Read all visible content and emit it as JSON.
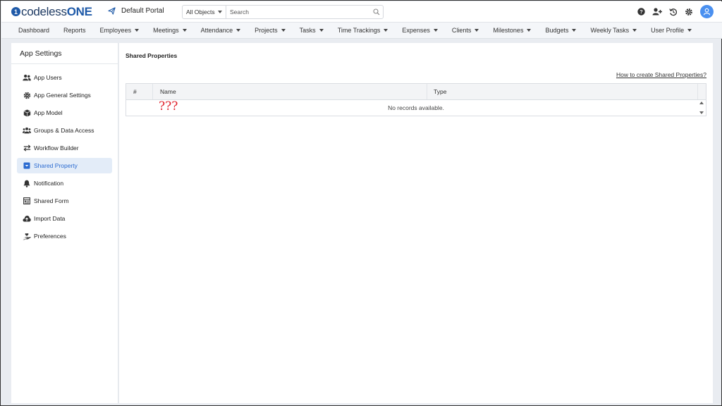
{
  "brand": {
    "logo_mark": "1",
    "logo_pre": "codeless",
    "logo_post": "ONE"
  },
  "portal": {
    "name": "Default Portal",
    "icon": "send-icon"
  },
  "search": {
    "scope": "All Objects",
    "placeholder": "Search"
  },
  "top_icons": [
    "help-icon",
    "add-user-icon",
    "history-icon",
    "settings-icon",
    "user-avatar-icon"
  ],
  "nav": {
    "items": [
      {
        "label": "Dashboard",
        "dropdown": false
      },
      {
        "label": "Reports",
        "dropdown": false
      },
      {
        "label": "Employees",
        "dropdown": true
      },
      {
        "label": "Meetings",
        "dropdown": true
      },
      {
        "label": "Attendance",
        "dropdown": true
      },
      {
        "label": "Projects",
        "dropdown": true
      },
      {
        "label": "Tasks",
        "dropdown": true
      },
      {
        "label": "Time Trackings",
        "dropdown": true
      },
      {
        "label": "Expenses",
        "dropdown": true
      },
      {
        "label": "Clients",
        "dropdown": true
      },
      {
        "label": "Milestones",
        "dropdown": true
      },
      {
        "label": "Budgets",
        "dropdown": true
      },
      {
        "label": "Weekly Tasks",
        "dropdown": true
      },
      {
        "label": "User Profile",
        "dropdown": true
      }
    ]
  },
  "sidebar": {
    "title": "App Settings",
    "items": [
      {
        "label": "App Users",
        "icon": "users-icon",
        "active": false
      },
      {
        "label": "App General Settings",
        "icon": "gear-icon",
        "active": false
      },
      {
        "label": "App Model",
        "icon": "cube-icon",
        "active": false
      },
      {
        "label": "Groups & Data Access",
        "icon": "group-icon",
        "active": false
      },
      {
        "label": "Workflow Builder",
        "icon": "swap-arrows-icon",
        "active": false
      },
      {
        "label": "Shared Property",
        "icon": "dropdown-box-icon",
        "active": true
      },
      {
        "label": "Notification",
        "icon": "bell-icon",
        "active": false
      },
      {
        "label": "Shared Form",
        "icon": "form-icon",
        "active": false
      },
      {
        "label": "Import Data",
        "icon": "cloud-upload-icon",
        "active": false
      },
      {
        "label": "Preferences",
        "icon": "hand-heart-icon",
        "active": false
      }
    ]
  },
  "main": {
    "title": "Shared Properties",
    "help_link": "How to create Shared Properties?",
    "columns": [
      "#",
      "Name",
      "Type"
    ],
    "empty_message": "No records available.",
    "overlay_marks": "???"
  },
  "colors": {
    "accent": "#2a6ad0",
    "brand": "#1f5aa8",
    "active_bg": "#e3ecf8",
    "marks": "#e0202a"
  }
}
